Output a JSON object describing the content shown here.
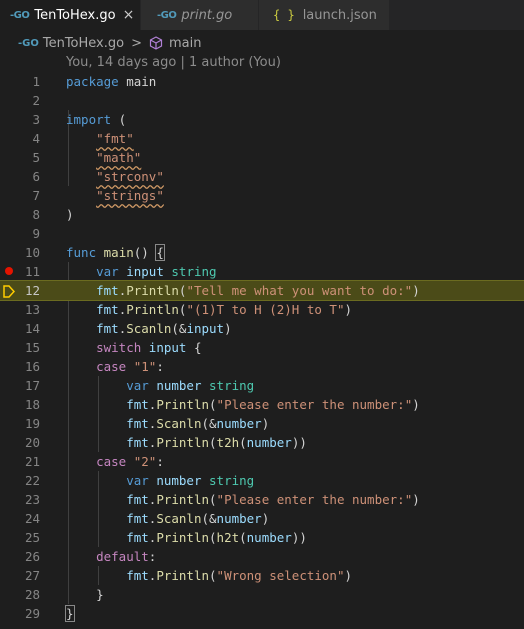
{
  "tabs": [
    {
      "label": "TenToHex.go",
      "icon": "go-icon",
      "active": true,
      "close": "×"
    },
    {
      "label": "print.go",
      "icon": "go-icon",
      "active": false
    },
    {
      "label": "launch.json",
      "icon": "json-icon",
      "active": false
    }
  ],
  "icons": {
    "go": "-GO",
    "json": "{ }"
  },
  "breadcrumb": {
    "file": "TenToHex.go",
    "separator": ">",
    "symbol": "main"
  },
  "blame": "You, 14 days ago | 1 author (You)",
  "debug": {
    "breakpoint_line": 11,
    "current_line": 12,
    "breakpoint_color": "#e51400",
    "current_line_color": "#ffcc00"
  },
  "lines": [
    {
      "n": "1",
      "tokens": [
        [
          "kw",
          "package"
        ],
        [
          "pl",
          " main"
        ]
      ]
    },
    {
      "n": "2",
      "tokens": []
    },
    {
      "n": "3",
      "tokens": [
        [
          "kw",
          "import"
        ],
        [
          "pl",
          " ("
        ]
      ]
    },
    {
      "n": "4",
      "tokens": [
        [
          "pl",
          "    "
        ],
        [
          "sq",
          "\"fmt\""
        ]
      ]
    },
    {
      "n": "5",
      "tokens": [
        [
          "pl",
          "    "
        ],
        [
          "sq",
          "\"math\""
        ]
      ]
    },
    {
      "n": "6",
      "tokens": [
        [
          "pl",
          "    "
        ],
        [
          "sq",
          "\"strconv\""
        ]
      ]
    },
    {
      "n": "7",
      "tokens": [
        [
          "pl",
          "    "
        ],
        [
          "sq",
          "\"strings\""
        ]
      ]
    },
    {
      "n": "8",
      "tokens": [
        [
          "pl",
          ")"
        ]
      ]
    },
    {
      "n": "9",
      "tokens": []
    },
    {
      "n": "10",
      "tokens": [
        [
          "kw",
          "func"
        ],
        [
          "pl",
          " "
        ],
        [
          "fn",
          "main"
        ],
        [
          "pl",
          "() "
        ],
        [
          "brk",
          "{"
        ]
      ]
    },
    {
      "n": "11",
      "tokens": [
        [
          "pl",
          "    "
        ],
        [
          "kw",
          "var"
        ],
        [
          "pl",
          " "
        ],
        [
          "vr",
          "input"
        ],
        [
          "pl",
          " "
        ],
        [
          "ty",
          "string"
        ]
      ]
    },
    {
      "n": "12",
      "tokens": [
        [
          "pl",
          "    "
        ],
        [
          "vr",
          "fmt"
        ],
        [
          "pl",
          "."
        ],
        [
          "fn",
          "Println"
        ],
        [
          "pl",
          "("
        ],
        [
          "st",
          "\"Tell me what you want to do:\""
        ],
        [
          "pl",
          ")"
        ]
      ]
    },
    {
      "n": "13",
      "tokens": [
        [
          "pl",
          "    "
        ],
        [
          "vr",
          "fmt"
        ],
        [
          "pl",
          "."
        ],
        [
          "fn",
          "Println"
        ],
        [
          "pl",
          "("
        ],
        [
          "st",
          "\"(1)T to H (2)H to T\""
        ],
        [
          "pl",
          ")"
        ]
      ]
    },
    {
      "n": "14",
      "tokens": [
        [
          "pl",
          "    "
        ],
        [
          "vr",
          "fmt"
        ],
        [
          "pl",
          "."
        ],
        [
          "fn",
          "Scanln"
        ],
        [
          "pl",
          "(&"
        ],
        [
          "vr",
          "input"
        ],
        [
          "pl",
          ")"
        ]
      ]
    },
    {
      "n": "15",
      "tokens": [
        [
          "pl",
          "    "
        ],
        [
          "kw2",
          "switch"
        ],
        [
          "pl",
          " "
        ],
        [
          "vr",
          "input"
        ],
        [
          "pl",
          " {"
        ]
      ]
    },
    {
      "n": "16",
      "tokens": [
        [
          "pl",
          "    "
        ],
        [
          "kw2",
          "case"
        ],
        [
          "pl",
          " "
        ],
        [
          "st",
          "\"1\""
        ],
        [
          "pl",
          ":"
        ]
      ]
    },
    {
      "n": "17",
      "tokens": [
        [
          "pl",
          "        "
        ],
        [
          "kw",
          "var"
        ],
        [
          "pl",
          " "
        ],
        [
          "vr",
          "number"
        ],
        [
          "pl",
          " "
        ],
        [
          "ty",
          "string"
        ]
      ]
    },
    {
      "n": "18",
      "tokens": [
        [
          "pl",
          "        "
        ],
        [
          "vr",
          "fmt"
        ],
        [
          "pl",
          "."
        ],
        [
          "fn",
          "Println"
        ],
        [
          "pl",
          "("
        ],
        [
          "st",
          "\"Please enter the number:\""
        ],
        [
          "pl",
          ")"
        ]
      ]
    },
    {
      "n": "19",
      "tokens": [
        [
          "pl",
          "        "
        ],
        [
          "vr",
          "fmt"
        ],
        [
          "pl",
          "."
        ],
        [
          "fn",
          "Scanln"
        ],
        [
          "pl",
          "(&"
        ],
        [
          "vr",
          "number"
        ],
        [
          "pl",
          ")"
        ]
      ]
    },
    {
      "n": "20",
      "tokens": [
        [
          "pl",
          "        "
        ],
        [
          "vr",
          "fmt"
        ],
        [
          "pl",
          "."
        ],
        [
          "fn",
          "Println"
        ],
        [
          "pl",
          "("
        ],
        [
          "fn",
          "t2h"
        ],
        [
          "pl",
          "("
        ],
        [
          "vr",
          "number"
        ],
        [
          "pl",
          "))"
        ]
      ]
    },
    {
      "n": "21",
      "tokens": [
        [
          "pl",
          "    "
        ],
        [
          "kw2",
          "case"
        ],
        [
          "pl",
          " "
        ],
        [
          "st",
          "\"2\""
        ],
        [
          "pl",
          ":"
        ]
      ]
    },
    {
      "n": "22",
      "tokens": [
        [
          "pl",
          "        "
        ],
        [
          "kw",
          "var"
        ],
        [
          "pl",
          " "
        ],
        [
          "vr",
          "number"
        ],
        [
          "pl",
          " "
        ],
        [
          "ty",
          "string"
        ]
      ]
    },
    {
      "n": "23",
      "tokens": [
        [
          "pl",
          "        "
        ],
        [
          "vr",
          "fmt"
        ],
        [
          "pl",
          "."
        ],
        [
          "fn",
          "Println"
        ],
        [
          "pl",
          "("
        ],
        [
          "st",
          "\"Please enter the number:\""
        ],
        [
          "pl",
          ")"
        ]
      ]
    },
    {
      "n": "24",
      "tokens": [
        [
          "pl",
          "        "
        ],
        [
          "vr",
          "fmt"
        ],
        [
          "pl",
          "."
        ],
        [
          "fn",
          "Scanln"
        ],
        [
          "pl",
          "(&"
        ],
        [
          "vr",
          "number"
        ],
        [
          "pl",
          ")"
        ]
      ]
    },
    {
      "n": "25",
      "tokens": [
        [
          "pl",
          "        "
        ],
        [
          "vr",
          "fmt"
        ],
        [
          "pl",
          "."
        ],
        [
          "fn",
          "Println"
        ],
        [
          "pl",
          "("
        ],
        [
          "fn",
          "h2t"
        ],
        [
          "pl",
          "("
        ],
        [
          "vr",
          "number"
        ],
        [
          "pl",
          "))"
        ]
      ]
    },
    {
      "n": "26",
      "tokens": [
        [
          "pl",
          "    "
        ],
        [
          "kw2",
          "default"
        ],
        [
          "pl",
          ":"
        ]
      ]
    },
    {
      "n": "27",
      "tokens": [
        [
          "pl",
          "        "
        ],
        [
          "vr",
          "fmt"
        ],
        [
          "pl",
          "."
        ],
        [
          "fn",
          "Println"
        ],
        [
          "pl",
          "("
        ],
        [
          "st",
          "\"Wrong selection\""
        ],
        [
          "pl",
          ")"
        ]
      ]
    },
    {
      "n": "28",
      "tokens": [
        [
          "pl",
          "    }"
        ]
      ]
    },
    {
      "n": "29",
      "tokens": [
        [
          "brk",
          "}"
        ]
      ]
    }
  ]
}
